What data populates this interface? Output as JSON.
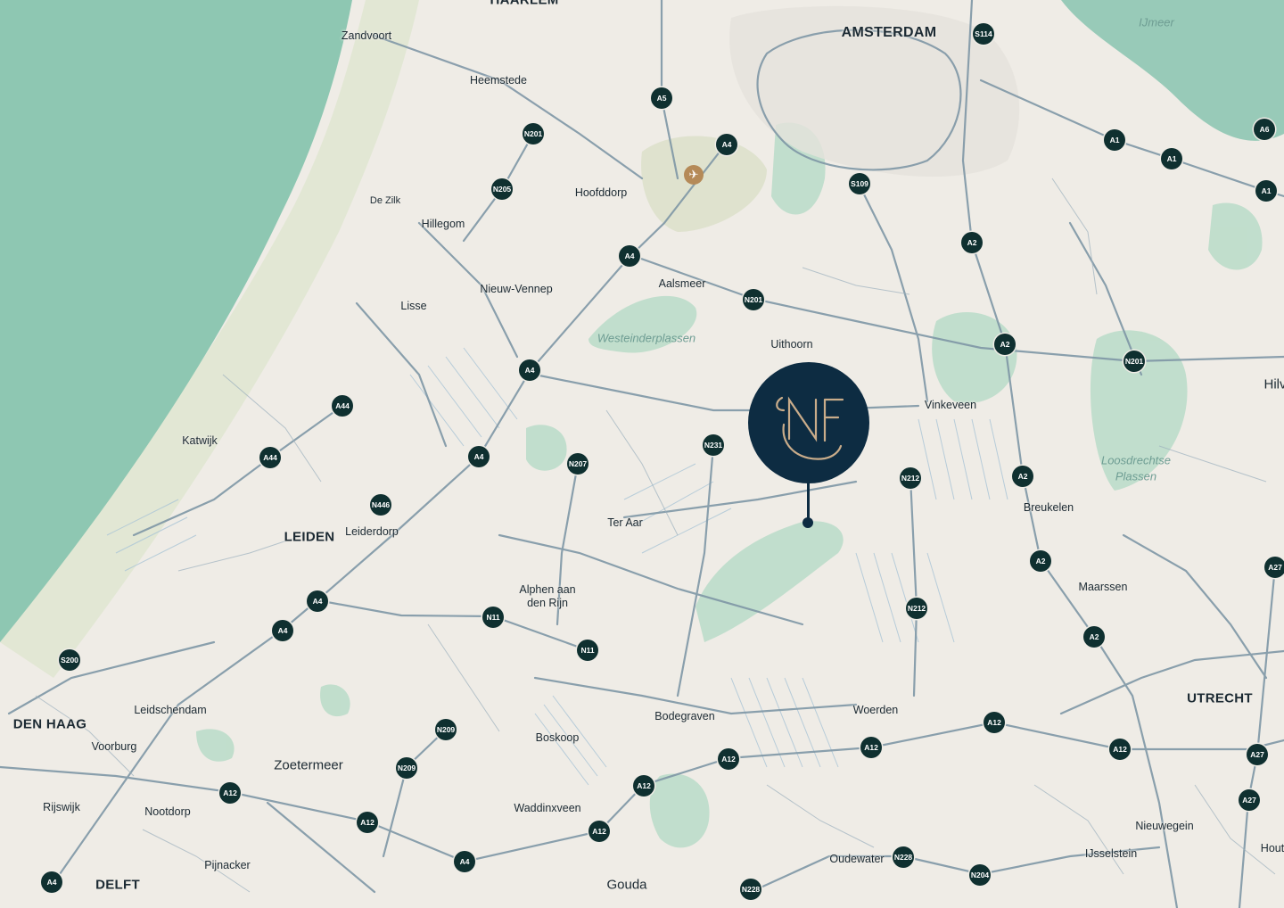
{
  "colors": {
    "sea": "#8ec7b2",
    "land": "#efece6",
    "park": "#b9dcc8",
    "roads": "#7f97a6",
    "water_lines": "#a9c4d6",
    "shield": "#0f3030",
    "marker": "#0d2c42",
    "monogram": "#c9ac8a",
    "airport": "#b58a58"
  },
  "marker": {
    "monogram": "NF",
    "icon": "location-pin-icon"
  },
  "airport": {
    "icon": "airplane-icon",
    "glyph": "✈"
  },
  "labels": [
    {
      "id": "amsterdam",
      "text": "AMSTERDAM",
      "kind": "city"
    },
    {
      "id": "leiden",
      "text": "LEIDEN",
      "kind": "city"
    },
    {
      "id": "denhaag",
      "text": "DEN HAAG",
      "kind": "city"
    },
    {
      "id": "utrecht",
      "text": "UTRECHT",
      "kind": "city"
    },
    {
      "id": "delft",
      "text": "DELFT",
      "kind": "city"
    },
    {
      "id": "haarlem",
      "text": "HAARLEM",
      "kind": "city"
    },
    {
      "id": "zandvoort",
      "text": "Zandvoort",
      "kind": "town"
    },
    {
      "id": "heemstede",
      "text": "Heemstede",
      "kind": "town"
    },
    {
      "id": "hoofddorp",
      "text": "Hoofddorp",
      "kind": "town"
    },
    {
      "id": "dezilk",
      "text": "De Zilk",
      "kind": "small"
    },
    {
      "id": "hillegom",
      "text": "Hillegom",
      "kind": "town"
    },
    {
      "id": "nieuwvennep",
      "text": "Nieuw-Vennep",
      "kind": "town"
    },
    {
      "id": "aalsmeer",
      "text": "Aalsmeer",
      "kind": "town"
    },
    {
      "id": "lisse",
      "text": "Lisse",
      "kind": "town"
    },
    {
      "id": "uithoorn",
      "text": "Uithoorn",
      "kind": "town"
    },
    {
      "id": "vinkeveen",
      "text": "Vinkeveen",
      "kind": "town"
    },
    {
      "id": "katwijk",
      "text": "Katwijk",
      "kind": "town"
    },
    {
      "id": "leiderdorp",
      "text": "Leiderdorp",
      "kind": "town"
    },
    {
      "id": "teraar",
      "text": "Ter Aar",
      "kind": "town"
    },
    {
      "id": "breukelen",
      "text": "Breukelen",
      "kind": "town"
    },
    {
      "id": "alphen1",
      "text": "Alphen aan",
      "kind": "town"
    },
    {
      "id": "alphen2",
      "text": "den Rijn",
      "kind": "town"
    },
    {
      "id": "maarssen",
      "text": "Maarssen",
      "kind": "town"
    },
    {
      "id": "leidschendam",
      "text": "Leidschendam",
      "kind": "town"
    },
    {
      "id": "voorburg",
      "text": "Voorburg",
      "kind": "town"
    },
    {
      "id": "bodegraven",
      "text": "Bodegraven",
      "kind": "town"
    },
    {
      "id": "woerden",
      "text": "Woerden",
      "kind": "town"
    },
    {
      "id": "boskoop",
      "text": "Boskoop",
      "kind": "town"
    },
    {
      "id": "zoetermeer",
      "text": "Zoetermeer",
      "kind": "big"
    },
    {
      "id": "rijswijk",
      "text": "Rijswijk",
      "kind": "town"
    },
    {
      "id": "nootdorp",
      "text": "Nootdorp",
      "kind": "town"
    },
    {
      "id": "waddinxveen",
      "text": "Waddinxveen",
      "kind": "town"
    },
    {
      "id": "nieuwegein",
      "text": "Nieuwegein",
      "kind": "town"
    },
    {
      "id": "pijnacker",
      "text": "Pijnacker",
      "kind": "town"
    },
    {
      "id": "oudewater",
      "text": "Oudewater",
      "kind": "town"
    },
    {
      "id": "ijsselstein",
      "text": "IJsselstein",
      "kind": "town"
    },
    {
      "id": "gouda",
      "text": "Gouda",
      "kind": "big"
    },
    {
      "id": "hilv",
      "text": "Hilv",
      "kind": "big"
    },
    {
      "id": "hout",
      "text": "Hout",
      "kind": "town"
    },
    {
      "id": "ijmeer",
      "text": "IJmeer",
      "kind": "water"
    },
    {
      "id": "westeinder",
      "text": "Westeinderplassen",
      "kind": "water"
    },
    {
      "id": "loosdrecht1",
      "text": "Loosdrechtse",
      "kind": "water"
    },
    {
      "id": "loosdrecht2",
      "text": "Plassen",
      "kind": "water"
    }
  ],
  "shields": [
    "S114",
    "A5",
    "N201",
    "A4",
    "A6",
    "A1",
    "A1",
    "N205",
    "S109",
    "A1",
    "A4",
    "A2",
    "N201",
    "A2",
    "N201",
    "A4",
    "A44",
    "N231",
    "N207",
    "A44",
    "A4",
    "A2",
    "N212",
    "N446",
    "A2",
    "A27",
    "A4",
    "N11",
    "N212",
    "A4",
    "A2",
    "S200",
    "N11",
    "A12",
    "N209",
    "A12",
    "A12",
    "A27",
    "N209",
    "A12",
    "A27",
    "A12",
    "A12",
    "A12",
    "N228",
    "A4",
    "A12",
    "N204",
    "N228"
  ]
}
